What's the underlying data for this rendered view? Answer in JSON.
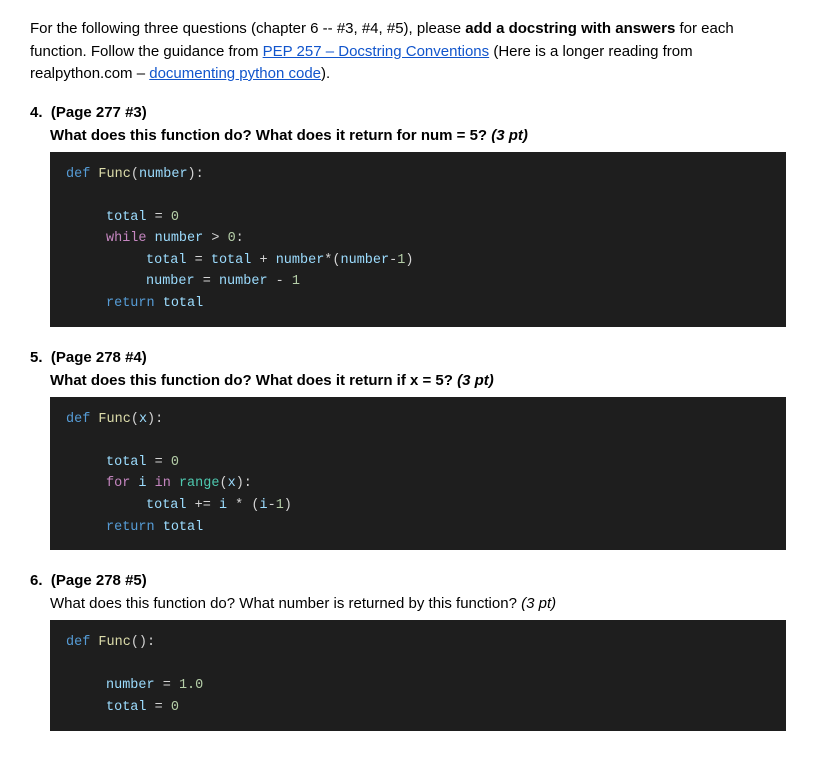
{
  "intro": {
    "text_part1": "For the following three questions (chapter 6 -- #3, #4, #5), please ",
    "bold_text": "add a docstring with answers",
    "text_part2": " for each function. Follow the guidance from ",
    "link1_text": "PEP 257 – Docstring Conventions",
    "link1_href": "#",
    "text_part3": " (Here is a longer reading from realpython.com – ",
    "link2_text": "documenting python code",
    "link2_href": "#",
    "text_part4": ")."
  },
  "questions": [
    {
      "number": "4.",
      "page_ref": "(Page 277 #3)",
      "title": "What does this function do? What does it return for num = 5?",
      "points": "(3 pt)",
      "subtitle": null
    },
    {
      "number": "5.",
      "page_ref": "(Page 278 #4)",
      "title": "What does this function do? What does it return if x = 5?",
      "points": "(3 pt)",
      "subtitle": null
    },
    {
      "number": "6.",
      "page_ref": "(Page 278 #5)",
      "title": "What does this function do? What number is returned by this function?",
      "points": "(3 pt)",
      "subtitle": null
    }
  ],
  "code_blocks": {
    "q4": [
      "def Func(number):",
      "",
      "    total = 0",
      "    while number > 0:",
      "        total = total + number*(number-1)",
      "        number = number - 1",
      "    return total"
    ],
    "q5": [
      "def Func(x):",
      "",
      "    total = 0",
      "    for i in range(x):",
      "        total += i * (i-1)",
      "    return total"
    ],
    "q6": [
      "def Func():",
      "",
      "    number = 1.0",
      "    total = 0"
    ]
  }
}
